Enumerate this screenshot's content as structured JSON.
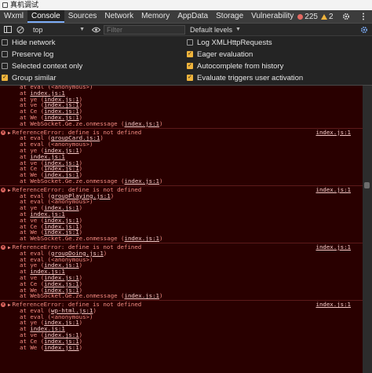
{
  "window": {
    "title": "真机调试"
  },
  "tabs": [
    "Wxml",
    "Console",
    "Sources",
    "Network",
    "Memory",
    "AppData",
    "Storage",
    "Vulnerability"
  ],
  "active_tab": "Console",
  "status": {
    "errors": "225",
    "warnings": "2"
  },
  "toolbar": {
    "context": "top",
    "filter_placeholder": "Filter",
    "levels": "Default levels"
  },
  "settings": {
    "left": [
      {
        "label": "Hide network",
        "checked": false
      },
      {
        "label": "Preserve log",
        "checked": false
      },
      {
        "label": "Selected context only",
        "checked": false
      },
      {
        "label": "Group similar",
        "checked": true
      }
    ],
    "right": [
      {
        "label": "Log XMLHttpRequests",
        "checked": false
      },
      {
        "label": "Eager evaluation",
        "checked": true
      },
      {
        "label": "Autocomplete from history",
        "checked": true
      },
      {
        "label": "Evaluate triggers user activation",
        "checked": true
      }
    ]
  },
  "colors": {
    "error_text": "#f28b82",
    "error_bg": "#290000",
    "accent": "#7cacf8",
    "checkbox": "#f0b43c"
  },
  "messages": [
    {
      "partial": true,
      "frames": [
        [
          "at eval (",
          "",
          "<anonymous>)"
        ],
        [
          "at ",
          "index.js:1",
          ""
        ],
        [
          "at ye (",
          "index.js:1",
          ")"
        ],
        [
          "at ve (",
          "index.js:1",
          ")"
        ],
        [
          "at Ce (",
          "index.js:1",
          ")"
        ],
        [
          "at We (",
          "index.js:1",
          ")"
        ],
        [
          "at WebSocket.Ge.ze.onmessage (",
          "index.js:1",
          ")"
        ]
      ]
    },
    {
      "text": "ReferenceError: define is not defined",
      "source": "index.js:1",
      "frames": [
        [
          "at eval (",
          "groupCard.js:1",
          ")"
        ],
        [
          "at eval (",
          "",
          "<anonymous>)"
        ],
        [
          "at ye (",
          "index.js:1",
          ")"
        ],
        [
          "at ",
          "index.js:1",
          ""
        ],
        [
          "at ve (",
          "index.js:1",
          ")"
        ],
        [
          "at Ce (",
          "index.js:1",
          ")"
        ],
        [
          "at We (",
          "index.js:1",
          ")"
        ],
        [
          "at WebSocket.Ge.ze.onmessage (",
          "index.js:1",
          ")"
        ]
      ]
    },
    {
      "text": "ReferenceError: define is not defined",
      "source": "index.js:1",
      "frames": [
        [
          "at eval (",
          "groupPlaying.js:1",
          ")"
        ],
        [
          "at eval (",
          "",
          "<anonymous>)"
        ],
        [
          "at ye (",
          "index.js:1",
          ")"
        ],
        [
          "at ",
          "index.js:1",
          ""
        ],
        [
          "at ve (",
          "index.js:1",
          ")"
        ],
        [
          "at Ce (",
          "index.js:1",
          ")"
        ],
        [
          "at We (",
          "index.js:1",
          ")"
        ],
        [
          "at WebSocket.Ge.ze.onmessage (",
          "index.js:1",
          ")"
        ]
      ]
    },
    {
      "text": "ReferenceError: define is not defined",
      "source": "index.js:1",
      "frames": [
        [
          "at eval (",
          "groupDoing.js:1",
          ")"
        ],
        [
          "at eval (",
          "",
          "<anonymous>)"
        ],
        [
          "at ye (",
          "index.js:1",
          ")"
        ],
        [
          "at ",
          "index.js:1",
          ""
        ],
        [
          "at ve (",
          "index.js:1",
          ")"
        ],
        [
          "at Ce (",
          "index.js:1",
          ")"
        ],
        [
          "at We (",
          "index.js:1",
          ")"
        ],
        [
          "at WebSocket.Ge.ze.onmessage (",
          "index.js:1",
          ")"
        ]
      ]
    },
    {
      "text": "ReferenceError: define is not defined",
      "source": "index.js:1",
      "frames": [
        [
          "at eval (",
          "wp-html.js:1",
          ")"
        ],
        [
          "at eval (",
          "",
          "<anonymous>)"
        ],
        [
          "at ye (",
          "index.js:1",
          ")"
        ],
        [
          "at ",
          "index.js:1",
          ""
        ],
        [
          "at ve (",
          "index.js:1",
          ")"
        ],
        [
          "at Ce (",
          "index.js:1",
          ")"
        ],
        [
          "at We (",
          "index.js:1",
          ")"
        ]
      ]
    }
  ]
}
